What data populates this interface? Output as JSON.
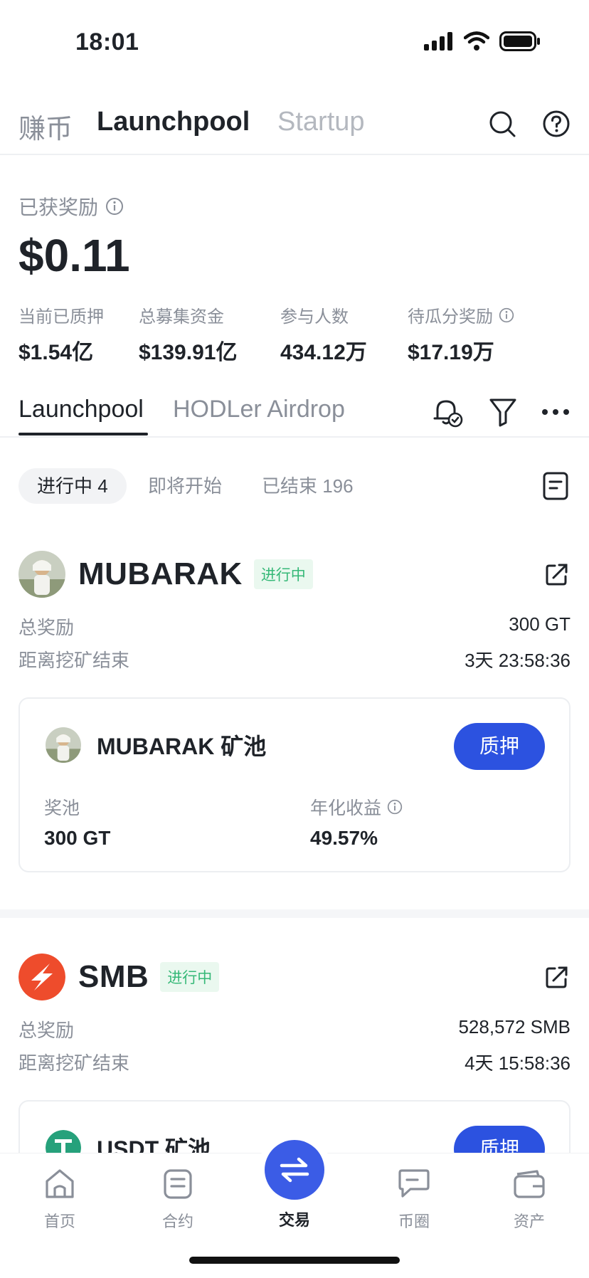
{
  "status_bar": {
    "time": "18:01"
  },
  "top_nav": {
    "earn": "赚币",
    "launchpool": "Launchpool",
    "startup": "Startup"
  },
  "rewards": {
    "label": "已获奖励",
    "value": "$0.11",
    "stats": [
      {
        "label": "当前已质押",
        "value": "$1.54亿"
      },
      {
        "label": "总募集资金",
        "value": "$139.91亿"
      },
      {
        "label": "参与人数",
        "value": "434.12万"
      },
      {
        "label": "待瓜分奖励",
        "value": "$17.19万"
      }
    ]
  },
  "sub_tabs": {
    "active": "Launchpool",
    "other": "HODLer Airdrop"
  },
  "filters": [
    {
      "label": "进行中 4"
    },
    {
      "label": "即将开始"
    },
    {
      "label": "已结束 196"
    }
  ],
  "projects": [
    {
      "name": "MUBARAK",
      "status": "进行中",
      "total_reward_label": "总奖励",
      "total_reward": "300 GT",
      "end_label": "距离挖矿结束",
      "end_countdown": "3天 23:58:36",
      "pool": {
        "title": "MUBARAK 矿池",
        "stake_label": "质押",
        "pool_label": "奖池",
        "pool_value": "300 GT",
        "apr_label": "年化收益",
        "apr_value": "49.57%"
      }
    },
    {
      "name": "SMB",
      "status": "进行中",
      "total_reward_label": "总奖励",
      "total_reward": "528,572 SMB",
      "end_label": "距离挖矿结束",
      "end_countdown": "4天 15:58:36",
      "pool": {
        "title": "USDT 矿池",
        "stake_label": "质押"
      }
    }
  ],
  "bottom_nav": [
    {
      "label": "首页",
      "icon": "home-icon"
    },
    {
      "label": "合约",
      "icon": "contract-icon"
    },
    {
      "label": "交易",
      "icon": "swap-icon"
    },
    {
      "label": "币圈",
      "icon": "chat-icon"
    },
    {
      "label": "资产",
      "icon": "wallet-icon"
    }
  ],
  "colors": {
    "primary": "#2c52e0",
    "status_green": "#35b877",
    "trade": "#3b5ce6"
  }
}
